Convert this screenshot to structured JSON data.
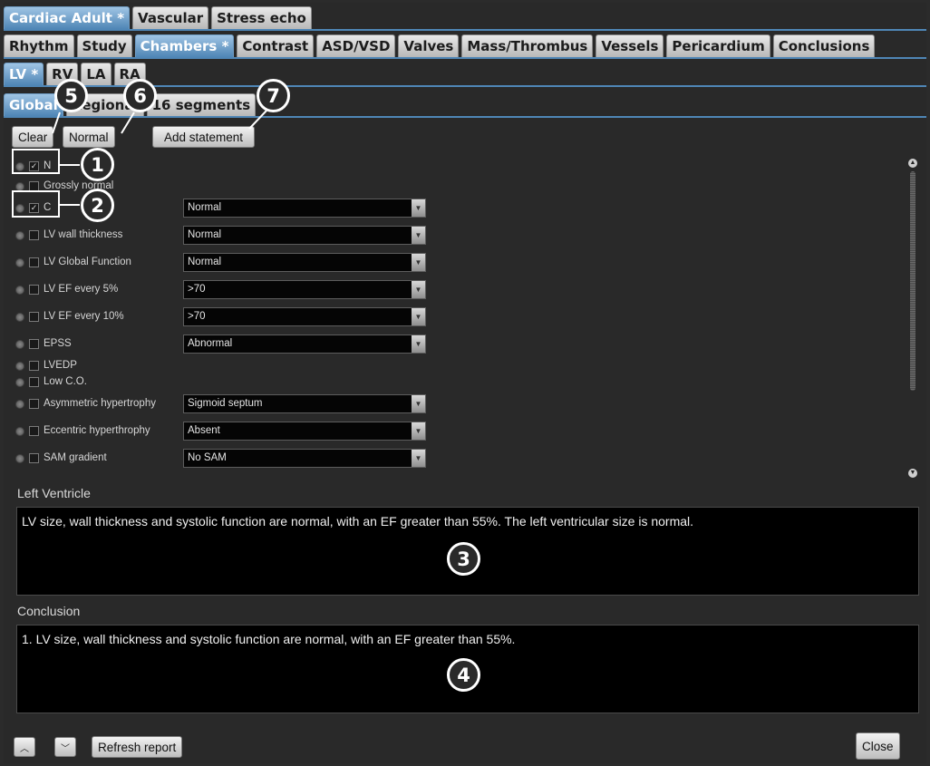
{
  "tabs_level1": [
    "Cardiac Adult *",
    "Vascular",
    "Stress echo"
  ],
  "tabs_level2": [
    "Rhythm",
    "Study",
    "Chambers *",
    "Contrast",
    "ASD/VSD",
    "Valves",
    "Mass/Thrombus",
    "Vessels",
    "Pericardium",
    "Conclusions"
  ],
  "tabs_level3": [
    "LV *",
    "RV",
    "LA",
    "RA"
  ],
  "tabs_level4": [
    "Global",
    "Regional",
    "16 segments"
  ],
  "buttons": {
    "clear": "Clear",
    "normal": "Normal",
    "add_statement": "Add statement",
    "refresh": "Refresh report",
    "close": "Close"
  },
  "rows": [
    {
      "label": "N",
      "checked": true,
      "dropdown": ""
    },
    {
      "label": "Grossly normal",
      "checked": false,
      "dropdown": ""
    },
    {
      "label": "C",
      "checked": true,
      "dropdown": "Normal"
    },
    {
      "label": "LV wall thickness",
      "checked": false,
      "dropdown": "Normal"
    },
    {
      "label": "LV Global Function",
      "checked": false,
      "dropdown": "Normal"
    },
    {
      "label": "LV EF every 5%",
      "checked": false,
      "dropdown": ">70"
    },
    {
      "label": "LV EF every 10%",
      "checked": false,
      "dropdown": ">70"
    },
    {
      "label": "EPSS",
      "checked": false,
      "dropdown": "Abnormal"
    },
    {
      "label": "LVEDP",
      "checked": false,
      "dropdown": ""
    },
    {
      "label": "Low C.O.",
      "checked": false,
      "dropdown": ""
    },
    {
      "label": "Asymmetric hypertrophy",
      "checked": false,
      "dropdown": "Sigmoid septum"
    },
    {
      "label": "Eccentric hyperthrophy",
      "checked": false,
      "dropdown": "Absent"
    },
    {
      "label": "SAM gradient",
      "checked": false,
      "dropdown": "No SAM"
    }
  ],
  "left_ventricle": {
    "label": "Left Ventricle",
    "text": "LV size, wall thickness and systolic function are normal, with an EF greater than 55%. The left ventricular size is normal."
  },
  "conclusion": {
    "label": "Conclusion",
    "text": "1. LV size, wall thickness and systolic function are normal, with an EF greater than 55%."
  },
  "icons": {
    "up": "chevron-up-icon",
    "down": "chevron-down-icon"
  },
  "callouts": [
    "1",
    "2",
    "3",
    "4",
    "5",
    "6",
    "7"
  ],
  "colors": {
    "active_tab": "#4f86b6",
    "background": "#292929",
    "text_box": "#000000"
  }
}
